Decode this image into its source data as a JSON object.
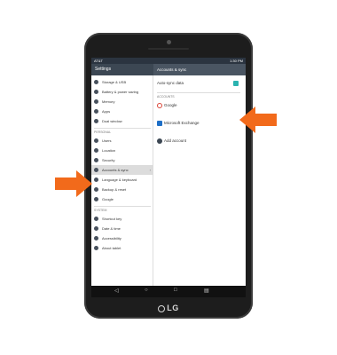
{
  "status": {
    "carrier": "AT&T",
    "time": "1:30 PM"
  },
  "app": {
    "title": "Settings"
  },
  "left": {
    "items": [
      {
        "label": "Storage & USB"
      },
      {
        "label": "Battery & power saving"
      },
      {
        "label": "Memory"
      },
      {
        "label": "Apps"
      },
      {
        "label": "Dual window"
      }
    ],
    "personal_header": "PERSONAL",
    "personal": [
      {
        "label": "Users"
      },
      {
        "label": "Location"
      },
      {
        "label": "Security"
      },
      {
        "label": "Accounts & sync"
      },
      {
        "label": "Language & keyboard"
      },
      {
        "label": "Backup & reset"
      },
      {
        "label": "Google"
      }
    ],
    "system_header": "SYSTEM",
    "system": [
      {
        "label": "Shortcut key"
      },
      {
        "label": "Date & time"
      },
      {
        "label": "Accessibility"
      },
      {
        "label": "About tablet"
      }
    ]
  },
  "right": {
    "title": "Accounts & sync",
    "autosync": "Auto-sync data",
    "accounts_header": "ACCOUNTS",
    "accounts": [
      {
        "label": "Google"
      },
      {
        "label": "Microsoft Exchange"
      },
      {
        "label": "Add account"
      }
    ]
  },
  "brand": {
    "logo": "LG"
  },
  "colors": {
    "accent": "#f26a1b",
    "toggle": "#2bb3b0"
  }
}
